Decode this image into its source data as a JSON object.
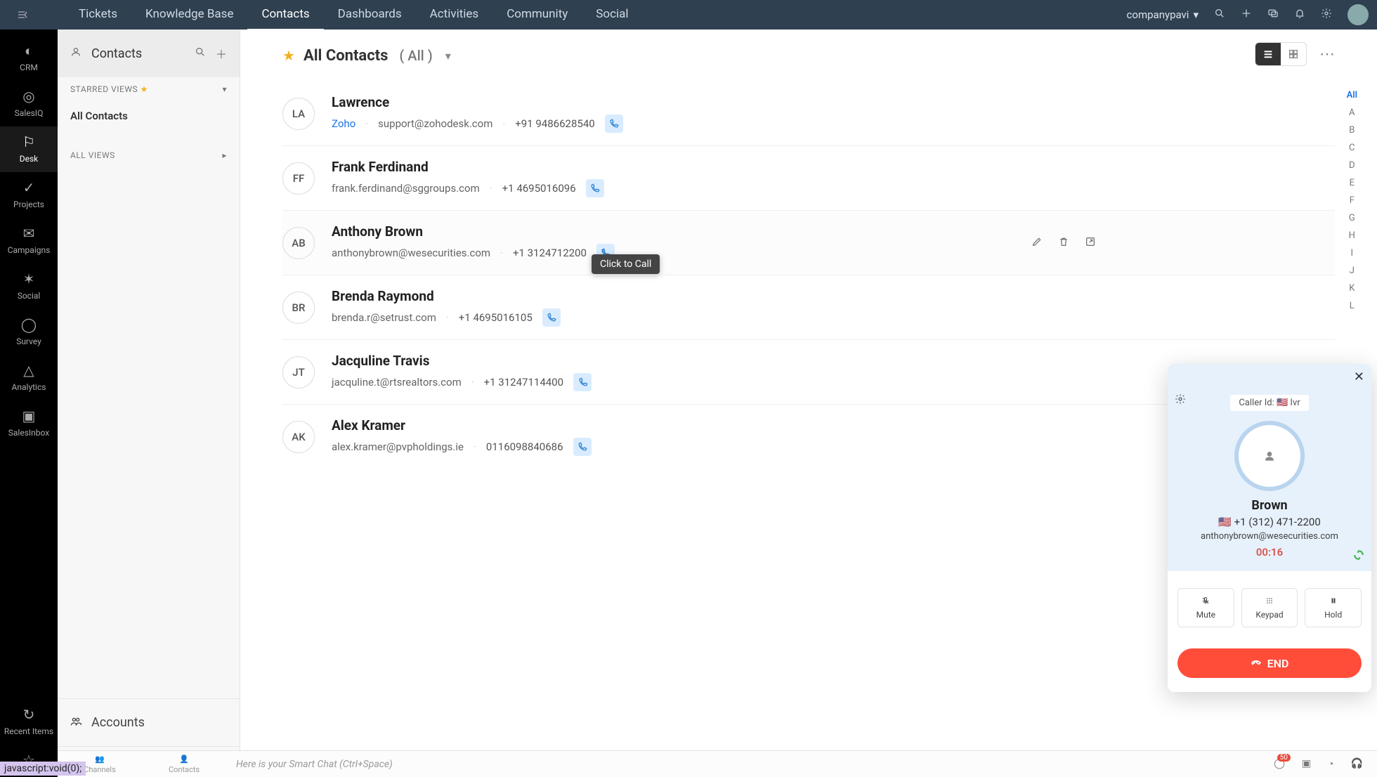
{
  "topbar": {
    "tabs": [
      "Tickets",
      "Knowledge Base",
      "Contacts",
      "Dashboards",
      "Activities",
      "Community",
      "Social"
    ],
    "active_tab_index": 2,
    "company": "companypavi"
  },
  "left_rail": {
    "apps": [
      {
        "label": "CRM"
      },
      {
        "label": "SalesIQ"
      },
      {
        "label": "Desk"
      },
      {
        "label": "Projects"
      },
      {
        "label": "Campaigns"
      },
      {
        "label": "Social"
      },
      {
        "label": "Survey"
      },
      {
        "label": "Analytics"
      },
      {
        "label": "SalesInbox"
      }
    ],
    "active_index": 2,
    "recent_label": "Recent Items"
  },
  "sec_sidebar": {
    "head_title": "Contacts",
    "starred_label": "STARRED VIEWS",
    "allviews_label": "ALL VIEWS",
    "starred_items": [
      "All Contacts"
    ],
    "accounts_label": "Accounts"
  },
  "main": {
    "title": "All Contacts",
    "subtitle": "( All )"
  },
  "alpha_index": [
    "All",
    "A",
    "B",
    "C",
    "D",
    "E",
    "F",
    "G",
    "H",
    "I",
    "J",
    "K",
    "L"
  ],
  "contacts": [
    {
      "initials": "LA",
      "name": "Lawrence",
      "org": "Zoho",
      "email": "support@zohodesk.com",
      "phone": "+91 9486628540"
    },
    {
      "initials": "FF",
      "name": "Frank Ferdinand",
      "org": "",
      "email": "frank.ferdinand@sggroups.com",
      "phone": "+1 4695016096"
    },
    {
      "initials": "AB",
      "name": "Anthony Brown",
      "org": "",
      "email": "anthonybrown@wesecurities.com",
      "phone": "+1 3124712200"
    },
    {
      "initials": "BR",
      "name": "Brenda Raymond",
      "org": "",
      "email": "brenda.r@setrust.com",
      "phone": "+1 4695016105"
    },
    {
      "initials": "JT",
      "name": "Jacquline Travis",
      "org": "",
      "email": "jacquline.t@rtsrealtors.com",
      "phone": "+1 31247114400"
    },
    {
      "initials": "AK",
      "name": "Alex Kramer",
      "org": "",
      "email": "alex.kramer@pvpholdings.ie",
      "phone": "0116098840686"
    }
  ],
  "tooltip": {
    "text": "Click to Call"
  },
  "call": {
    "callerid_label": "Caller Id:",
    "callerid_value": "Ivr",
    "name": "Brown",
    "phone": "+1 (312) 471-2200",
    "email": "anthonybrown@wesecurities.com",
    "timer": "00:16",
    "mute": "Mute",
    "keypad": "Keypad",
    "hold": "Hold",
    "end": "END"
  },
  "bottom": {
    "channels": "Channels",
    "contacts": "Contacts",
    "smart": "Here is your Smart Chat (Ctrl+Space)",
    "badge": "50"
  },
  "status_url": "javascript:void(0);"
}
